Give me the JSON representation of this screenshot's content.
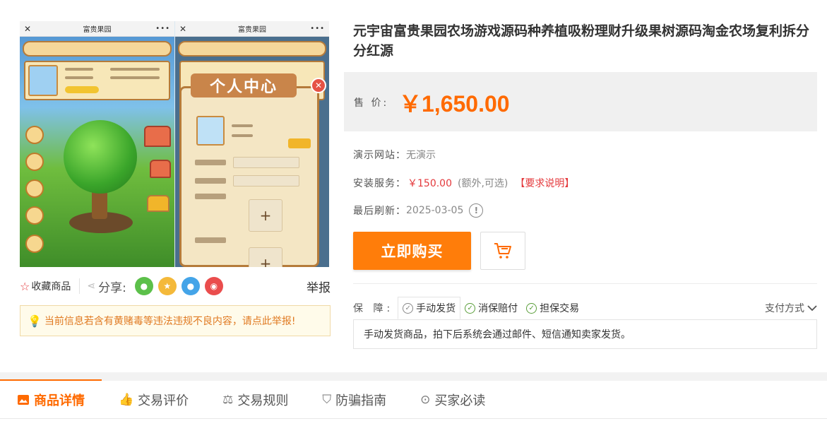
{
  "gallery": {
    "screen1_title": "富贵果园",
    "screen2_title": "富贵果园",
    "overlay_title": "个人中心"
  },
  "share": {
    "favorite_label": "收藏商品",
    "share_label": "分享:",
    "report_label": "举报"
  },
  "warning": {
    "text": "当前信息若含有黄赌毒等违法违规不良内容，请点此举报!"
  },
  "product": {
    "title": "元宇宙富贵果园农场游戏源码种养植吸粉理财升级果树源码淘金农场复利拆分分红源",
    "price_label": "售 价:",
    "price": "￥1,650.00",
    "demo_label": "演示网站：",
    "demo_value": "无演示",
    "install_label": "安装服务：",
    "install_price": "￥150.00",
    "install_note": "(额外,可选)",
    "install_requirements": "【要求说明】",
    "refresh_label": "最后刷新：",
    "refresh_date": "2025-03-05",
    "buy_label": "立即购买"
  },
  "guarantee": {
    "label": "保 障:",
    "items": [
      "手动发货",
      "消保赔付",
      "担保交易"
    ],
    "payment_label": "支付方式",
    "description": "手动发货商品，拍下后系统会通过邮件、短信通知卖家发货。"
  },
  "tabs": [
    {
      "label": "商品详情",
      "icon": "image-icon"
    },
    {
      "label": "交易评价",
      "icon": "thumb-up-icon"
    },
    {
      "label": "交易规则",
      "icon": "scale-icon"
    },
    {
      "label": "防骗指南",
      "icon": "shield-bulb-icon"
    },
    {
      "label": "买家必读",
      "icon": "compass-icon"
    }
  ],
  "colors": {
    "accent": "#ff6a00",
    "buy_button": "#ff7d0a",
    "price_box_bg": "#f0f0f0",
    "warning_text": "#e07a22"
  }
}
